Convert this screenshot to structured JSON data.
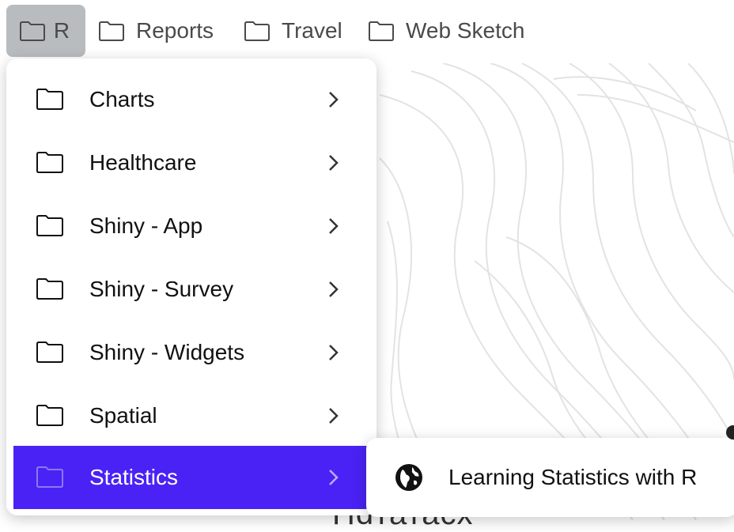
{
  "bookmarks": [
    {
      "label": "R",
      "icon": "folder-icon"
    },
    {
      "label": "Reports",
      "icon": "folder-icon"
    },
    {
      "label": "Travel",
      "icon": "folder-icon"
    },
    {
      "label": "Web Sketch",
      "icon": "folder-icon"
    }
  ],
  "menu": {
    "items": [
      {
        "label": "Charts",
        "icon": "folder-icon",
        "has_submenu": true
      },
      {
        "label": "Healthcare",
        "icon": "folder-icon",
        "has_submenu": true
      },
      {
        "label": "Shiny - App",
        "icon": "folder-icon",
        "has_submenu": true
      },
      {
        "label": "Shiny - Survey",
        "icon": "folder-icon",
        "has_submenu": true
      },
      {
        "label": "Shiny - Widgets",
        "icon": "folder-icon",
        "has_submenu": true
      },
      {
        "label": "Spatial",
        "icon": "folder-icon",
        "has_submenu": true
      },
      {
        "label": "Statistics",
        "icon": "folder-icon",
        "has_submenu": true,
        "selected": true
      }
    ]
  },
  "submenu": {
    "items": [
      {
        "label": "Learning Statistics with R",
        "icon": "globe-icon"
      }
    ]
  },
  "background": {
    "partial_text": "Hdтатасх"
  },
  "colors": {
    "selected_bg": "#4a22f5",
    "bookmark_active_bg": "#b9bcbf"
  }
}
